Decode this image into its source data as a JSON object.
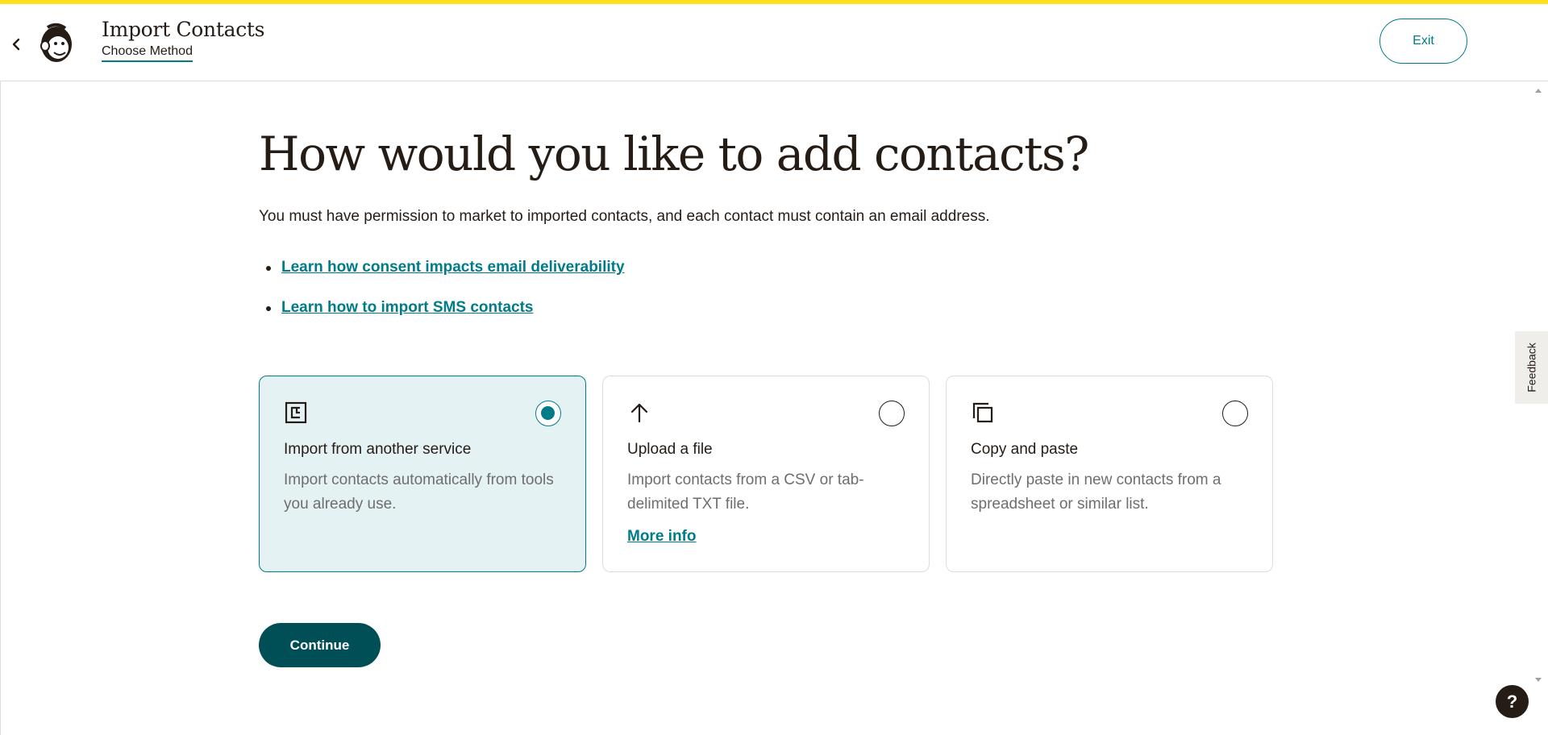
{
  "header": {
    "title": "Import Contacts",
    "subtitle": "Choose Method",
    "exit_label": "Exit"
  },
  "main": {
    "heading": "How would you like to add contacts?",
    "intro": "You must have permission to market to imported contacts, and each contact must contain an email address.",
    "links": [
      {
        "label": "Learn how consent impacts email deliverability"
      },
      {
        "label": "Learn how to import SMS contacts"
      }
    ],
    "options": [
      {
        "title": "Import from another service",
        "description": "Import contacts automatically from tools you already use.",
        "icon": "integration-icon",
        "selected": true
      },
      {
        "title": "Upload a file",
        "description": "Import contacts from a CSV or tab-delimited TXT file.",
        "link": "More info",
        "icon": "upload-arrow-icon",
        "selected": false
      },
      {
        "title": "Copy and paste",
        "description": "Directly paste in new contacts from a spreadsheet or similar list.",
        "icon": "copy-icon",
        "selected": false
      }
    ],
    "continue_label": "Continue"
  },
  "feedback_label": "Feedback",
  "help_label": "?",
  "colors": {
    "accent": "#007c89",
    "primary_button": "#004e56",
    "top_bar": "#ffe01b",
    "selected_card": "#e5f2f3"
  }
}
